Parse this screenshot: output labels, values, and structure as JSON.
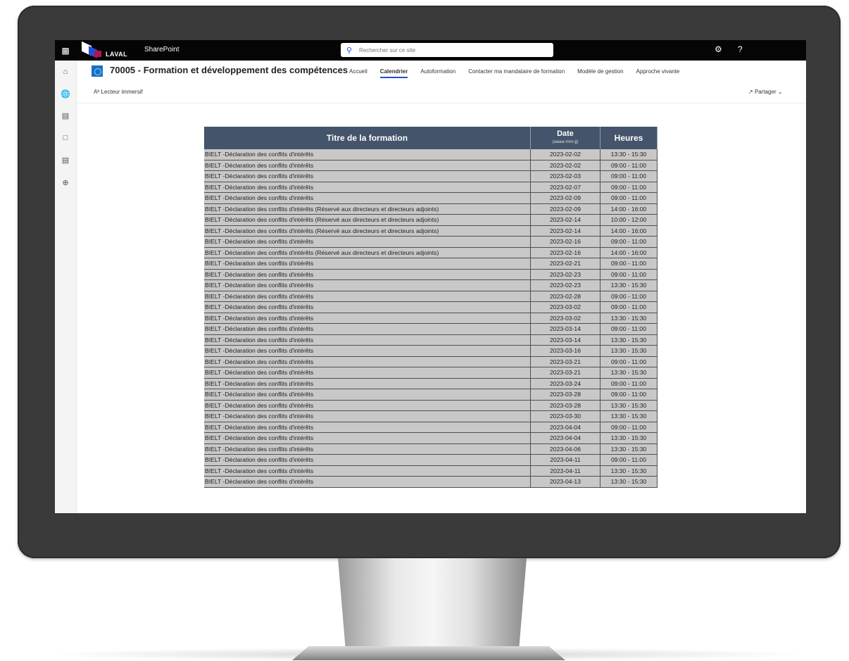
{
  "suitebar": {
    "brand": "LAVAL",
    "app": "SharePoint",
    "search_placeholder": "Rechercher sur ce site"
  },
  "site": {
    "title": "70005 - Formation et développement des compétences",
    "nav": [
      {
        "label": "Accueil",
        "active": false
      },
      {
        "label": "Calendrier",
        "active": true
      },
      {
        "label": "Autoformation",
        "active": false
      },
      {
        "label": "Contacter ma mandataire de formation",
        "active": false
      },
      {
        "label": "Modèle de gestion",
        "active": false
      },
      {
        "label": "Approche vivante",
        "active": false
      }
    ]
  },
  "commandbar": {
    "reader": "Lecteur immersif",
    "share": "Partager"
  },
  "table": {
    "headers": {
      "title": "Titre de la formation",
      "date": "Date",
      "date_sub": "(aaaa-mm-jj)",
      "hours": "Heures"
    },
    "rows": [
      {
        "title": "BIELT -Déclaration des conflits d'intérêts",
        "date": "2023-02-02",
        "hours": "13:30 - 15:30"
      },
      {
        "title": "BIELT -Déclaration des conflits d'intérêts",
        "date": "2023-02-02",
        "hours": "09:00 - 11:00"
      },
      {
        "title": "BIELT -Déclaration des conflits d'intérêts",
        "date": "2023-02-03",
        "hours": "09:00 - 11:00"
      },
      {
        "title": "BIELT -Déclaration des conflits d'intérêts",
        "date": "2023-02-07",
        "hours": "09:00 - 11:00"
      },
      {
        "title": "BIELT -Déclaration des conflits d'intérêts",
        "date": "2023-02-09",
        "hours": "09:00 - 11:00"
      },
      {
        "title": "BIELT -Déclaration des conflits d'intérêts (Réservé aux directeurs et directeurs adjoints)",
        "date": "2023-02-09",
        "hours": "14:00 - 16:00"
      },
      {
        "title": "BIELT -Déclaration des conflits d'intérêts (Réservé aux directeurs et directeurs adjoints)",
        "date": "2023-02-14",
        "hours": "10:00 - 12:00"
      },
      {
        "title": "BIELT -Déclaration des conflits d'intérêts (Réservé aux directeurs et directeurs adjoints)",
        "date": "2023-02-14",
        "hours": "14:00 - 16:00"
      },
      {
        "title": "BIELT -Déclaration des conflits d'intérêts",
        "date": "2023-02-16",
        "hours": "09:00 - 11:00"
      },
      {
        "title": "BIELT -Déclaration des conflits d'intérêts (Réservé aux directeurs et directeurs adjoints)",
        "date": "2023-02-16",
        "hours": "14:00 - 16:00"
      },
      {
        "title": "BIELT -Déclaration des conflits d'intérêts",
        "date": "2023-02-21",
        "hours": "09:00 - 11:00"
      },
      {
        "title": "BIELT -Déclaration des conflits d'intérêts",
        "date": "2023-02-23",
        "hours": "09:00 - 11:00"
      },
      {
        "title": "BIELT -Déclaration des conflits d'intérêts",
        "date": "2023-02-23",
        "hours": "13:30 - 15:30"
      },
      {
        "title": "BIELT -Déclaration des conflits d'intérêts",
        "date": "2023-02-28",
        "hours": "09:00 - 11:00"
      },
      {
        "title": "BIELT -Déclaration des conflits d'intérêts",
        "date": "2023-03-02",
        "hours": "09:00 - 11:00"
      },
      {
        "title": "BIELT -Déclaration des conflits d'intérêts",
        "date": "2023-03-02",
        "hours": "13:30 - 15:30"
      },
      {
        "title": "BIELT -Déclaration des conflits d'intérêts",
        "date": "2023-03-14",
        "hours": "09:00 - 11:00"
      },
      {
        "title": "BIELT -Déclaration des conflits d'intérêts",
        "date": "2023-03-14",
        "hours": "13:30 - 15:30"
      },
      {
        "title": "BIELT -Déclaration des conflits d'intérêts",
        "date": "2023-03-16",
        "hours": "13:30 - 15:30"
      },
      {
        "title": "BIELT -Déclaration des conflits d'intérêts",
        "date": "2023-03-21",
        "hours": "09:00 - 11:00"
      },
      {
        "title": "BIELT -Déclaration des conflits d'intérêts",
        "date": "2023-03-21",
        "hours": "13:30 - 15:30"
      },
      {
        "title": "BIELT -Déclaration des conflits d'intérêts",
        "date": "2023-03-24",
        "hours": "09:00 - 11:00"
      },
      {
        "title": "BIELT -Déclaration des conflits d'intérêts",
        "date": "2023-03-28",
        "hours": "09:00 - 11:00"
      },
      {
        "title": "BIELT -Déclaration des conflits d'intérêts",
        "date": "2023-03-28",
        "hours": "13:30 - 15:30"
      },
      {
        "title": "BIELT -Déclaration des conflits d'intérêts",
        "date": "2023-03-30",
        "hours": "13:30 - 15:30"
      },
      {
        "title": "BIELT -Déclaration des conflits d'intérêts",
        "date": "2023-04-04",
        "hours": "09:00 - 11:00"
      },
      {
        "title": "BIELT -Déclaration des conflits d'intérêts",
        "date": "2023-04-04",
        "hours": "13:30 - 15:30"
      },
      {
        "title": "BIELT -Déclaration des conflits d'intérêts",
        "date": "2023-04-06",
        "hours": "13:30 - 15:30"
      },
      {
        "title": "BIELT -Déclaration des conflits d'intérêts",
        "date": "2023-04-11",
        "hours": "09:00 - 11:00"
      },
      {
        "title": "BIELT -Déclaration des conflits d'intérêts",
        "date": "2023-04-11",
        "hours": "13:30 - 15:30"
      },
      {
        "title": "BIELT -Déclaration des conflits d'intérêts",
        "date": "2023-04-13",
        "hours": "13:30 - 15:30"
      }
    ]
  },
  "icons": {
    "waffle": "app-launcher-icon",
    "search": "search-icon",
    "gear": "settings-icon",
    "help": "help-icon",
    "rail": [
      "home-icon",
      "globe-icon",
      "news-icon",
      "files-icon",
      "lists-icon",
      "create-icon"
    ]
  },
  "colors": {
    "suitebar": "#050505",
    "accent": "#1f4fd6",
    "table_header": "#44546a",
    "table_cell": "#c8c8c8"
  }
}
